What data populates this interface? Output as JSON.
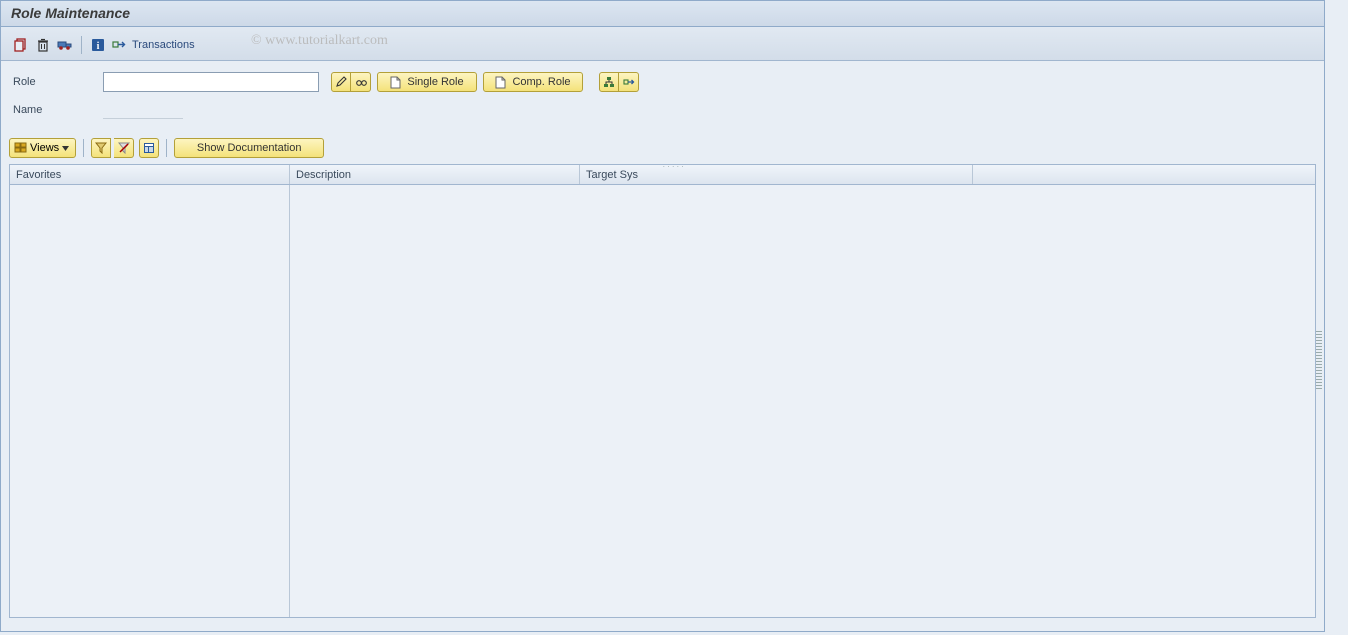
{
  "title": "Role Maintenance",
  "toolbar": {
    "transactions_label": "Transactions",
    "watermark": "© www.tutorialkart.com"
  },
  "form": {
    "role_label": "Role",
    "role_value": "",
    "name_label": "Name",
    "name_value": "",
    "single_role_label": "Single Role",
    "comp_role_label": "Comp. Role"
  },
  "subtoolbar": {
    "views_label": "Views",
    "show_doc_label": "Show Documentation"
  },
  "table": {
    "headers": {
      "favorites": "Favorites",
      "description": "Description",
      "target_sys": "Target Sys"
    }
  }
}
